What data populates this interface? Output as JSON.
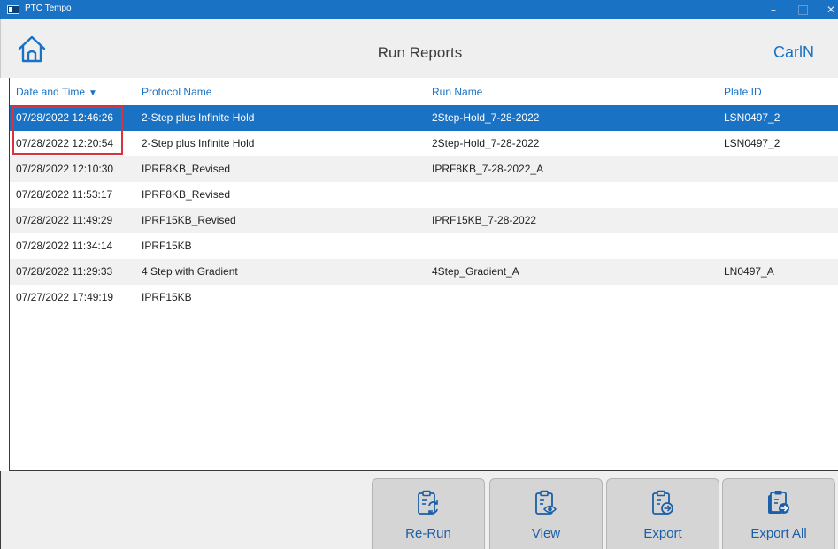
{
  "window": {
    "title": "PTC Tempo",
    "minimize_glyph": "–",
    "close_glyph": "✕"
  },
  "header": {
    "home_icon": "home-icon",
    "title": "Run Reports",
    "user": "CarlN"
  },
  "table": {
    "columns": {
      "date_time": "Date and Time",
      "sort_indicator": "▼",
      "protocol": "Protocol Name",
      "run": "Run Name",
      "plate": "Plate ID"
    },
    "rows": [
      {
        "date": "07/28/2022 12:46:26",
        "protocol": "2-Step plus Infinite Hold",
        "run": "2Step-Hold_7-28-2022",
        "plate": "LSN0497_2",
        "selected": true
      },
      {
        "date": "07/28/2022 12:20:54",
        "protocol": "2-Step plus Infinite Hold",
        "run": "2Step-Hold_7-28-2022",
        "plate": "LSN0497_2"
      },
      {
        "date": "07/28/2022 12:10:30",
        "protocol": "IPRF8KB_Revised",
        "run": "IPRF8KB_7-28-2022_A",
        "plate": ""
      },
      {
        "date": "07/28/2022 11:53:17",
        "protocol": "IPRF8KB_Revised",
        "run": "",
        "plate": ""
      },
      {
        "date": "07/28/2022 11:49:29",
        "protocol": "IPRF15KB_Revised",
        "run": "IPRF15KB_7-28-2022",
        "plate": ""
      },
      {
        "date": "07/28/2022 11:34:14",
        "protocol": "IPRF15KB",
        "run": "",
        "plate": ""
      },
      {
        "date": "07/28/2022 11:29:33",
        "protocol": "4 Step with Gradient",
        "run": "4Step_Gradient_A",
        "plate": "LN0497_A"
      },
      {
        "date": "07/27/2022 17:49:19",
        "protocol": "IPRF15KB",
        "run": "",
        "plate": ""
      }
    ]
  },
  "actions": {
    "rerun": {
      "label": "Re-Run",
      "icon": "clipboard-rerun-icon"
    },
    "view": {
      "label": "View",
      "icon": "clipboard-view-icon"
    },
    "export": {
      "label": "Export",
      "icon": "clipboard-export-icon"
    },
    "export_all": {
      "label": "Export All",
      "icon": "clipboard-export-all-icon"
    }
  },
  "colors": {
    "accent": "#1a72c4",
    "selected_row": "#1a72c4",
    "highlight_box": "#d9343d"
  }
}
